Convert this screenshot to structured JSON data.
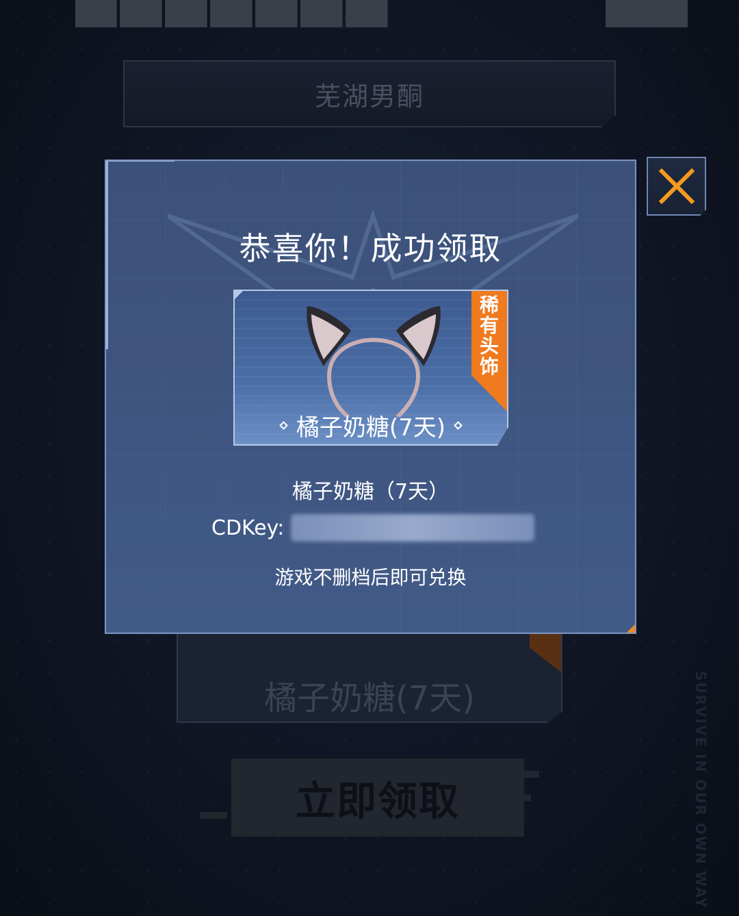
{
  "background": {
    "name_box_text": "芜湖男酮",
    "card_label": "橘子奶糖(7天)",
    "claim_button_label": "立即领取",
    "vertical_slogan": "SURVIVE IN OUR OWN WAY"
  },
  "modal": {
    "title": "恭喜你！成功领取",
    "item_card_label": "橘子奶糖(7天)",
    "rare_tag": "稀有头饰",
    "item_name": "橘子奶糖（7天）",
    "cdkey_label": "CDKey:",
    "cdkey_value": "",
    "hint": "游戏不删档后即可兑换",
    "close_icon": "close-icon"
  },
  "colors": {
    "accent_orange": "#f07a1e",
    "modal_bg": "#3e5580",
    "close_x": "#f59a1e"
  }
}
